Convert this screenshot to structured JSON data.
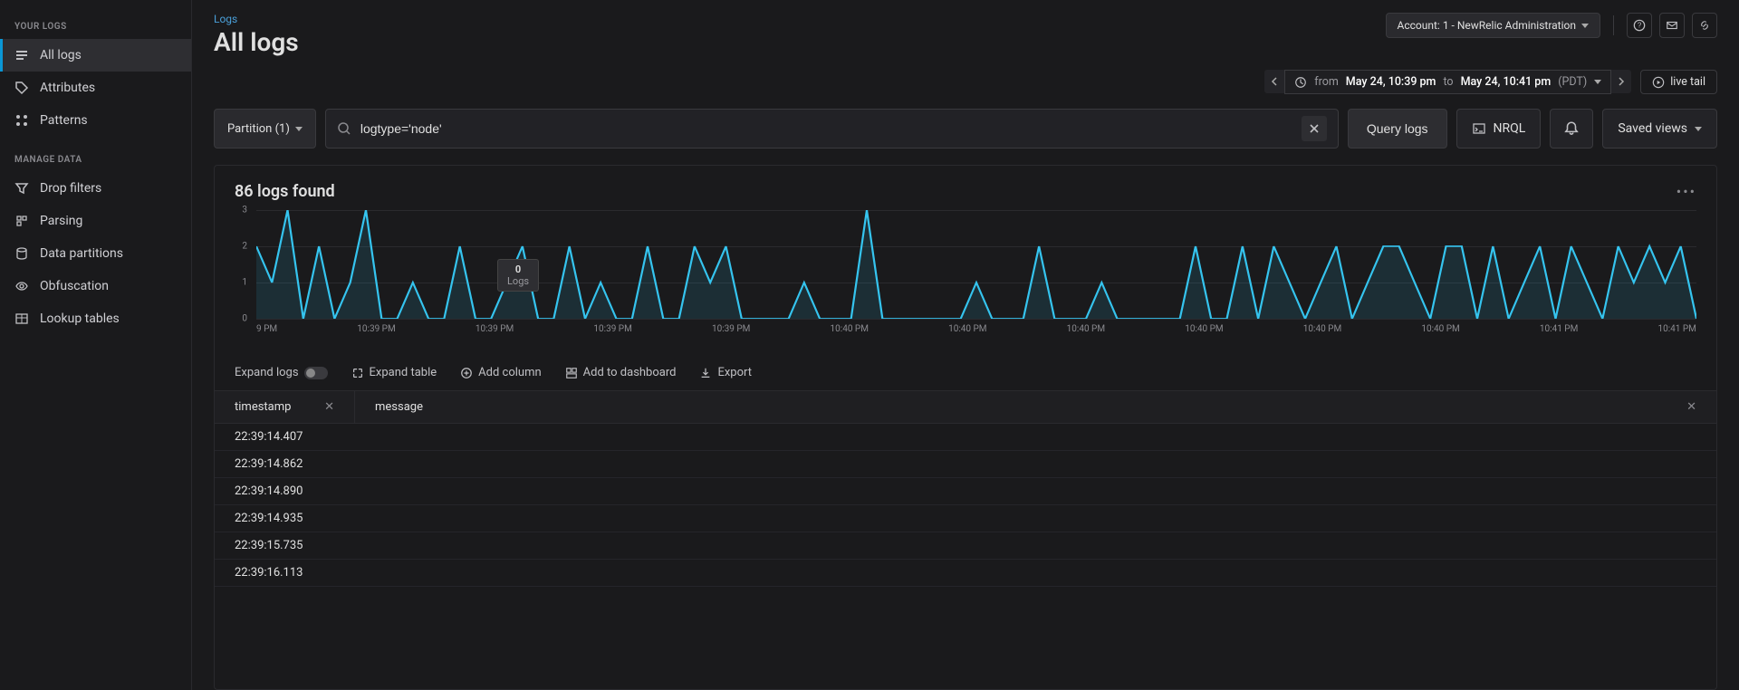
{
  "sidebar": {
    "sections": [
      {
        "label": "YOUR LOGS",
        "items": [
          {
            "key": "all-logs",
            "label": "All logs",
            "active": true
          },
          {
            "key": "attributes",
            "label": "Attributes"
          },
          {
            "key": "patterns",
            "label": "Patterns"
          }
        ]
      },
      {
        "label": "MANAGE DATA",
        "items": [
          {
            "key": "drop-filters",
            "label": "Drop filters"
          },
          {
            "key": "parsing",
            "label": "Parsing"
          },
          {
            "key": "data-partitions",
            "label": "Data partitions"
          },
          {
            "key": "obfuscation",
            "label": "Obfuscation"
          },
          {
            "key": "lookup-tables",
            "label": "Lookup tables"
          }
        ]
      }
    ]
  },
  "breadcrumb": "Logs",
  "page_title": "All logs",
  "account_label": "Account: 1 - NewRelic Administration",
  "timerange": {
    "prefix": "from",
    "start": "May 24, 10:39 pm",
    "mid": "to",
    "end": "May 24, 10:41 pm",
    "tz": "(PDT)"
  },
  "live_tail_label": "live tail",
  "partition_label": "Partition (1)",
  "search_value": "logtype='node'",
  "query_button": "Query logs",
  "nrql_button": "NRQL",
  "saved_views_label": "Saved views",
  "results_title": "86 logs found",
  "toolbar": {
    "expand_logs": "Expand logs",
    "expand_table": "Expand table",
    "add_column": "Add column",
    "add_dashboard": "Add to dashboard",
    "export": "Export"
  },
  "columns": {
    "timestamp": "timestamp",
    "message": "message"
  },
  "rows": [
    {
      "ts": "22:39:14.407"
    },
    {
      "ts": "22:39:14.862"
    },
    {
      "ts": "22:39:14.890"
    },
    {
      "ts": "22:39:14.935"
    },
    {
      "ts": "22:39:15.735"
    },
    {
      "ts": "22:39:16.113"
    }
  ],
  "chart_data": {
    "type": "line",
    "title": "",
    "ylabel": "",
    "ylim": [
      0,
      3
    ],
    "y_ticks": [
      0,
      1,
      2,
      3
    ],
    "x_ticks": [
      "9 PM",
      "10:39 PM",
      "10:39 PM",
      "10:39 PM",
      "10:39 PM",
      "10:40 PM",
      "10:40 PM",
      "10:40 PM",
      "10:40 PM",
      "10:40 PM",
      "10:40 PM",
      "10:41 PM",
      "10:41 PM"
    ],
    "tooltip": {
      "value": "0",
      "label": "Logs"
    },
    "values": [
      2,
      1,
      3,
      0,
      2,
      0,
      1,
      3,
      0,
      0,
      1,
      0,
      0,
      2,
      0,
      0,
      1,
      2,
      0,
      0,
      2,
      0,
      1,
      0,
      0,
      2,
      0,
      0,
      2,
      1,
      2,
      0,
      0,
      0,
      0,
      1,
      0,
      0,
      0,
      3,
      0,
      0,
      0,
      0,
      0,
      0,
      1,
      0,
      0,
      0,
      2,
      0,
      0,
      0,
      1,
      0,
      0,
      0,
      0,
      0,
      2,
      0,
      0,
      2,
      0,
      2,
      1,
      0,
      1,
      2,
      0,
      1,
      2,
      2,
      1,
      0,
      2,
      2,
      0,
      2,
      0,
      1,
      2,
      0,
      2,
      1,
      0,
      2,
      1,
      2,
      1,
      2,
      0
    ]
  },
  "colors": {
    "accent": "#35c4ef"
  }
}
